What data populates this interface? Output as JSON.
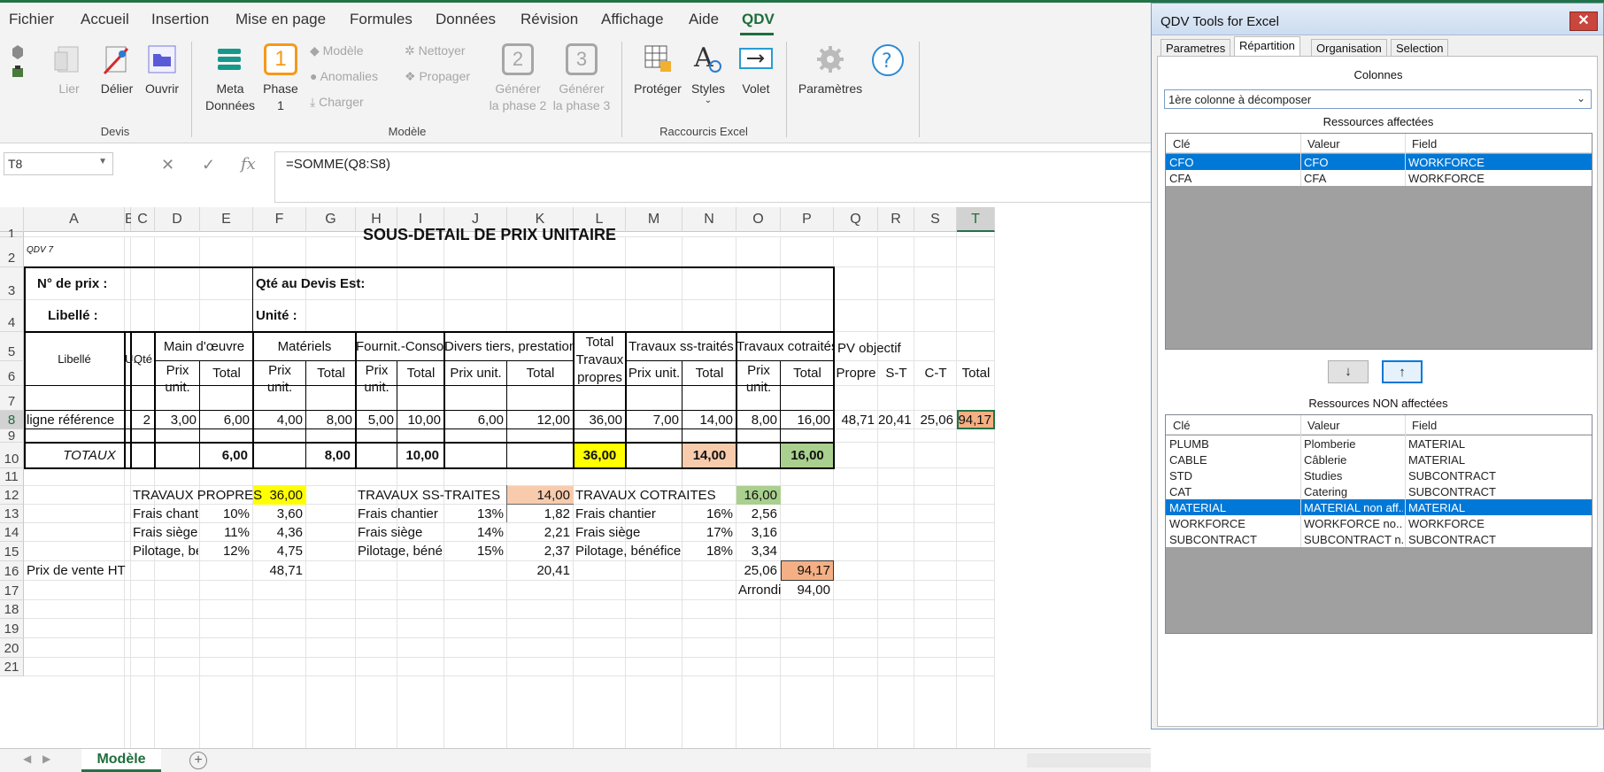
{
  "menu": {
    "items": [
      "Fichier",
      "Accueil",
      "Insertion",
      "Mise en page",
      "Formules",
      "Données",
      "Révision",
      "Affichage",
      "Aide",
      "QDV"
    ],
    "active": "QDV"
  },
  "ribbon": {
    "devis": {
      "group": "Devis",
      "lier": "Lier",
      "delier": "Délier",
      "ouvrir": "Ouvrir"
    },
    "modele": {
      "group": "Modèle",
      "meta": [
        "Meta",
        "Données"
      ],
      "phase": [
        "Phase",
        "1"
      ],
      "phase_num": "1",
      "modele": "Modèle",
      "anomalies": "Anomalies",
      "charger": "Charger",
      "nettoyer": "Nettoyer",
      "propager": "Propager",
      "gen2": [
        "Générer",
        "la phase 2"
      ],
      "gen2_num": "2",
      "gen3": [
        "Générer",
        "la phase 3"
      ],
      "gen3_num": "3"
    },
    "raccourcis": {
      "group": "Raccourcis Excel",
      "proteger": "Protéger",
      "styles": "Styles",
      "volet": "Volet"
    },
    "parametres": "Paramètres"
  },
  "formula_bar": {
    "cell": "T8",
    "formula": "=SOMME(Q8:S8)",
    "fx": "fx"
  },
  "columns": [
    "A",
    "B",
    "C",
    "D",
    "E",
    "F",
    "G",
    "H",
    "I",
    "J",
    "K",
    "L",
    "M",
    "N",
    "O",
    "P",
    "Q",
    "R",
    "S",
    "T"
  ],
  "rows": [
    "1",
    "2",
    "3",
    "4",
    "5",
    "6",
    "7",
    "8",
    "9",
    "10",
    "11",
    "12",
    "13",
    "14",
    "15",
    "16",
    "17",
    "18",
    "19",
    "20",
    "21"
  ],
  "sheet": {
    "title": "SOUS-DETAIL DE PRIX UNITAIRE",
    "qdv": "QDV 7",
    "no_prix": "N° de prix :",
    "qte_devis": "Qté au Devis Est:",
    "libelle_lbl": "Libellé :",
    "unite_lbl": "Unité :",
    "h_libelle": "Libellé",
    "h_u": "U.",
    "h_qte": "Qté",
    "h_main": "Main d'œuvre",
    "h_mat": "Matériels",
    "h_fourn": "Fournit.-Consom",
    "h_divers": "Divers tiers, prestations",
    "h_total_tp": [
      "Total",
      "Travaux",
      "propres"
    ],
    "h_ss": "Travaux ss-traités",
    "h_cot": "Travaux cotraités",
    "h_pv": "PV objectif",
    "prix_unit": [
      "Prix",
      "unit."
    ],
    "prix_unit_1": "Prix unit.",
    "total": "Total",
    "h_propre": "Propre",
    "h_st": "S-T",
    "h_ct": "C-T",
    "row8": {
      "lib": "ligne référence",
      "qte": "2",
      "d": "3,00",
      "e": "6,00",
      "f": "4,00",
      "g": "8,00",
      "h": "5,00",
      "i": "10,00",
      "j": "6,00",
      "k": "12,00",
      "l": "36,00",
      "m": "7,00",
      "n": "14,00",
      "o": "8,00",
      "p": "16,00",
      "q": "48,71",
      "r": "20,41",
      "s": "25,06",
      "t": "94,17"
    },
    "totaux": {
      "label": "TOTAUX",
      "e": "6,00",
      "g": "8,00",
      "i": "10,00",
      "l": "36,00",
      "n": "14,00",
      "p": "16,00"
    },
    "propres": {
      "label": "TRAVAUX PROPRES",
      "val": "36,00",
      "fc": "Frais chantier",
      "fc_p": "10%",
      "fc_v": "3,60",
      "fs": "Frais siège",
      "fs_p": "11%",
      "fs_v": "4,36",
      "pb": "Pilotage, bénéfice",
      "pb_p": "12%",
      "pb_v": "4,75"
    },
    "ss": {
      "label": "TRAVAUX SS-TRAITES",
      "val": "14,00",
      "fc": "Frais chantier",
      "fc_p": "13%",
      "fc_v": "1,82",
      "fs": "Frais siège",
      "fs_p": "14%",
      "fs_v": "2,21",
      "pb": "Pilotage, bénéfice",
      "pb_p": "15%",
      "pb_v": "2,37"
    },
    "cot": {
      "label": "TRAVAUX COTRAITES",
      "val": "16,00",
      "fc": "Frais chantier",
      "fc_p": "16%",
      "fc_v": "2,56",
      "fs": "Frais siège",
      "fs_p": "17%",
      "fs_v": "3,16",
      "pb": "Pilotage, bénéfice",
      "pb_p": "18%",
      "pb_v": "3,34"
    },
    "pv": {
      "label": "Prix de vente HT",
      "f": "48,71",
      "k": "20,41",
      "o": "25,06",
      "p": "94,17",
      "arrondi": "Arrondi",
      "arrondi_v": "94,00"
    }
  },
  "sheet_tab": "Modèle",
  "panel": {
    "title": "QDV Tools for Excel",
    "tabs": [
      "Parametres",
      "Répartition",
      "Organisation",
      "Selection"
    ],
    "active_tab": "Répartition",
    "colonnes": "Colonnes",
    "select": "1ère colonne à décomposer",
    "affectees": "Ressources affectées",
    "non_affectees": "Ressources NON affectées",
    "headers": [
      "Clé",
      "Valeur",
      "Field"
    ],
    "aff_rows": [
      [
        "CFO",
        "CFO",
        "WORKFORCE"
      ],
      [
        "CFA",
        "CFA",
        "WORKFORCE"
      ]
    ],
    "non_rows": [
      [
        "PLUMB",
        "Plomberie",
        "MATERIAL"
      ],
      [
        "CABLE",
        "Câblerie",
        "MATERIAL"
      ],
      [
        "STD",
        "Studies",
        "SUBCONTRACT"
      ],
      [
        "CAT",
        "Catering",
        "SUBCONTRACT"
      ],
      [
        "MATERIAL",
        "MATERIAL non aff...",
        "MATERIAL"
      ],
      [
        "WORKFORCE",
        "WORKFORCE no...",
        "WORKFORCE"
      ],
      [
        "SUBCONTRACT",
        "SUBCONTRACT n...",
        "SUBCONTRACT"
      ]
    ],
    "down": "↓",
    "up": "↑"
  },
  "colors": {
    "accent": "#217346",
    "yellow": "#ffff00",
    "salmon": "#f8cbad",
    "green": "#a9d08e",
    "orange": "#f4b084",
    "selection": "#0078d7"
  }
}
